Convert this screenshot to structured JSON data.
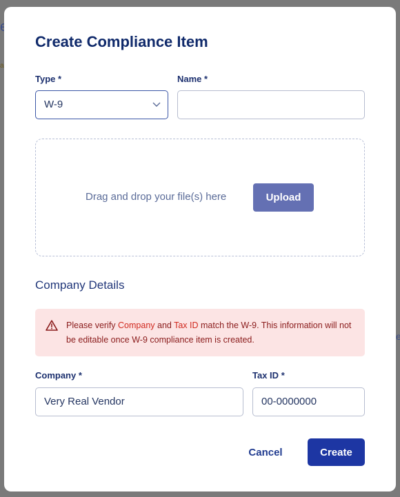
{
  "backdrop": {
    "left_fragment": "e",
    "left_fragment2": "a",
    "right_fragment": "e"
  },
  "modal": {
    "title": "Create Compliance Item",
    "type_field": {
      "label": "Type",
      "required_mark": "*",
      "value": "W-9",
      "icon": "chevron-down-icon"
    },
    "name_field": {
      "label": "Name",
      "required_mark": "*",
      "value": "",
      "placeholder": ""
    },
    "dropzone": {
      "text": "Drag and drop your file(s) here",
      "upload_label": "Upload"
    },
    "section_title": "Company Details",
    "alert": {
      "icon": "warning-icon",
      "prefix": "Please verify ",
      "company_word": "Company",
      "and_word": " and ",
      "taxid_word": "Tax ID",
      "suffix": " match the W-9. This information will not be editable once W-9 compliance item is created."
    },
    "company_field": {
      "label": "Company",
      "required_mark": "*",
      "value": "Very Real Vendor"
    },
    "taxid_field": {
      "label": "Tax ID",
      "required_mark": "*",
      "value": "00-0000000"
    },
    "actions": {
      "cancel_label": "Cancel",
      "create_label": "Create"
    }
  },
  "colors": {
    "primary": "#1d36a3",
    "upload": "#6470b3",
    "alert_bg": "#fce4e4",
    "alert_text": "#8a1b1b",
    "alert_highlight": "#d0281e",
    "title": "#102a6b"
  }
}
